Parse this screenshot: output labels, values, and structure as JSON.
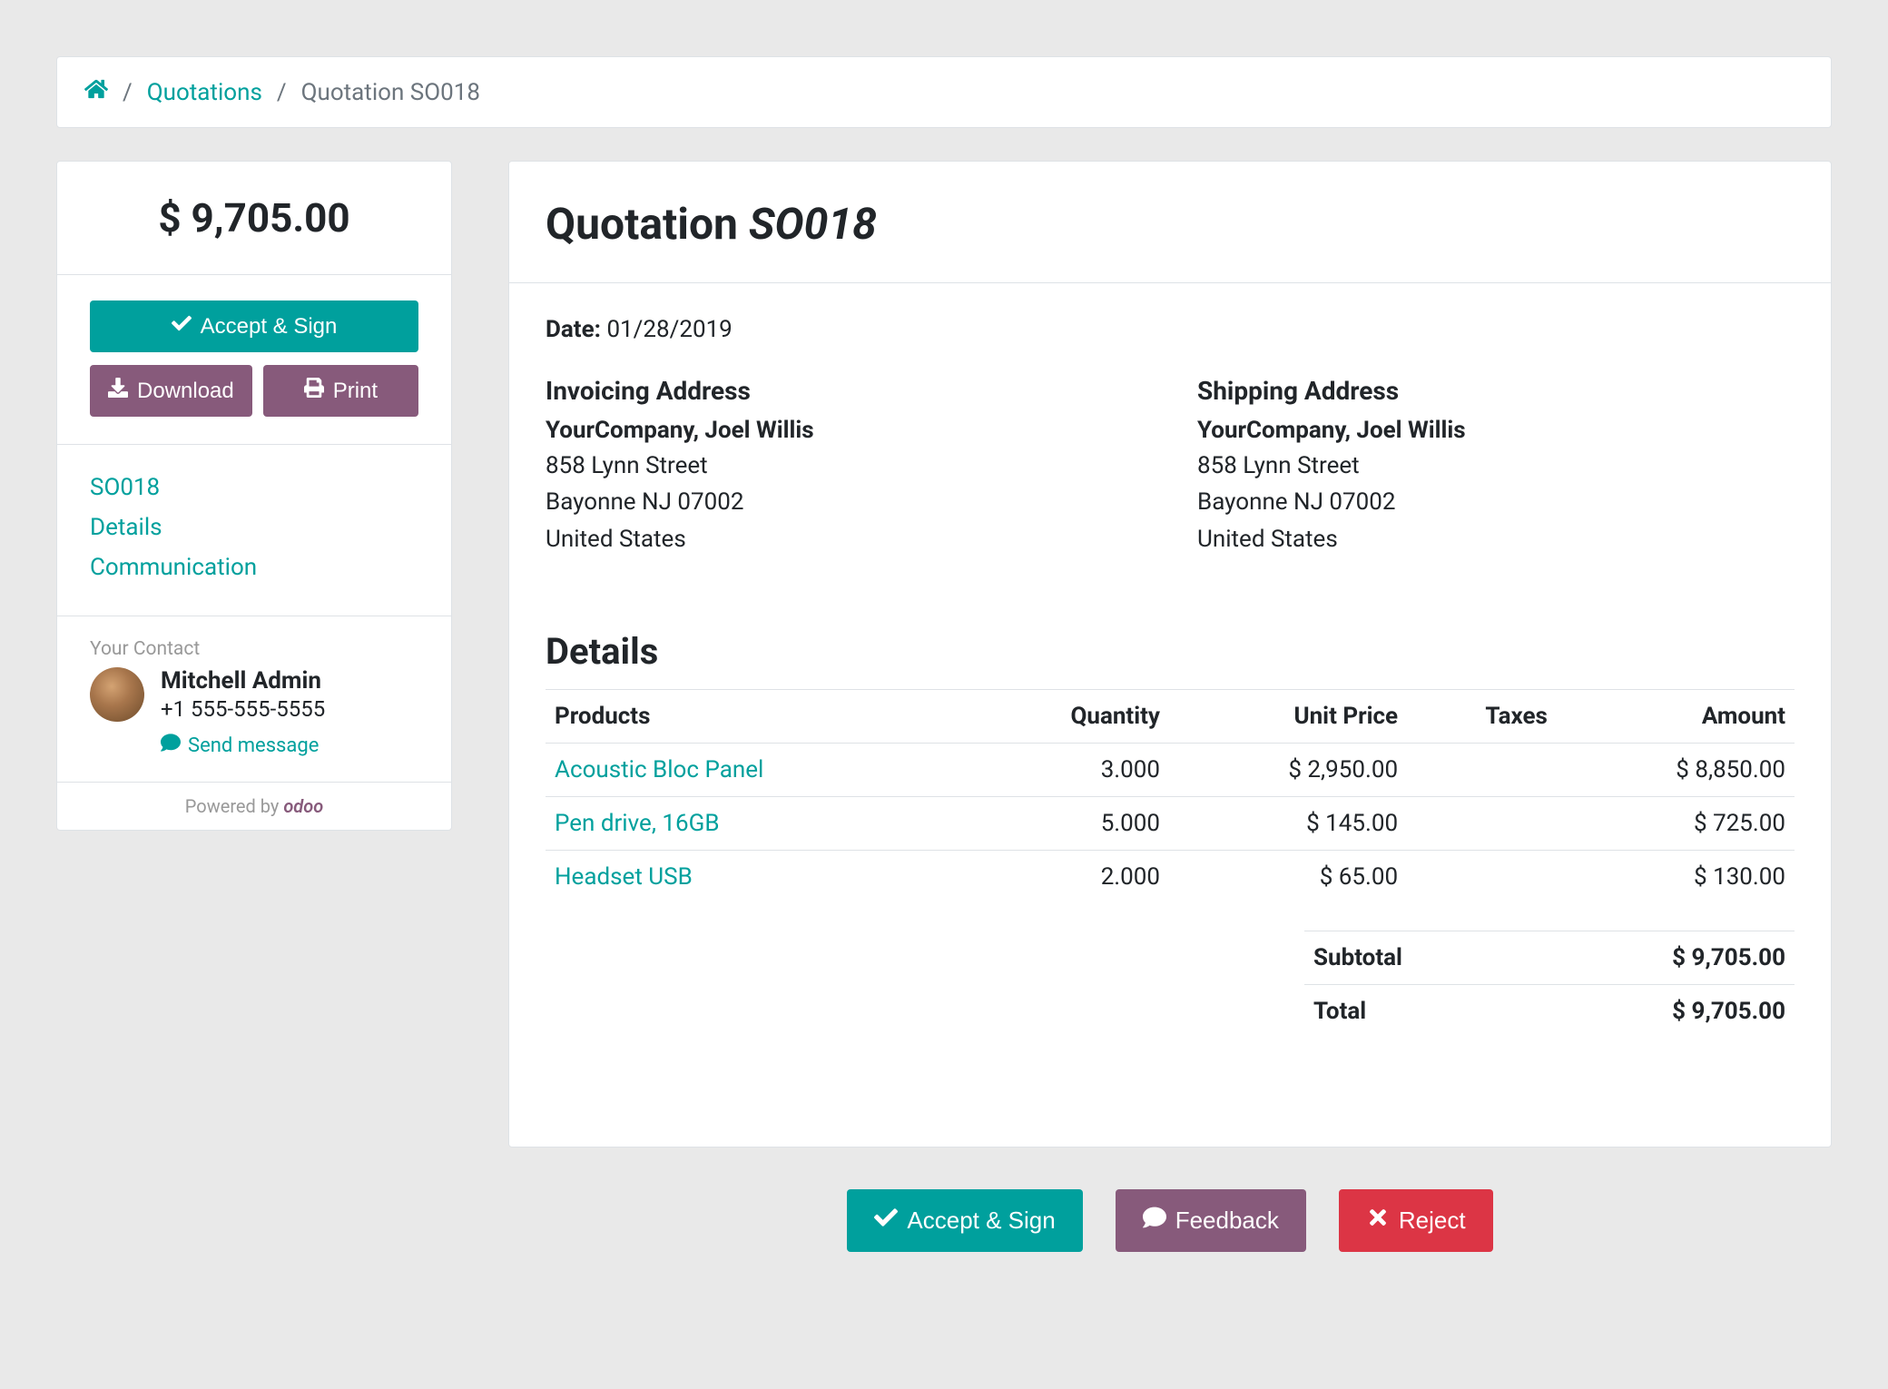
{
  "breadcrumb": {
    "quotations_label": "Quotations",
    "current_label": "Quotation SO018"
  },
  "sidebar": {
    "price": "$ 9,705.00",
    "accept_sign_label": "Accept & Sign",
    "download_label": "Download",
    "print_label": "Print",
    "nav": {
      "so_link": "SO018",
      "details_link": "Details",
      "communication_link": "Communication"
    },
    "contact": {
      "heading": "Your Contact",
      "name": "Mitchell Admin",
      "phone": "+1 555-555-5555",
      "send_msg_label": "Send message"
    },
    "powered_by_label": "Powered by",
    "powered_brand": "odoo"
  },
  "main": {
    "title_prefix": "Quotation ",
    "title_id": "SO018",
    "date_label": "Date:",
    "date_value": "01/28/2019",
    "invoicing_address": {
      "heading": "Invoicing Address",
      "company": "YourCompany, Joel Willis",
      "line1": "858 Lynn Street",
      "line2": "Bayonne NJ 07002",
      "country": "United States"
    },
    "shipping_address": {
      "heading": "Shipping Address",
      "company": "YourCompany, Joel Willis",
      "line1": "858 Lynn Street",
      "line2": "Bayonne NJ 07002",
      "country": "United States"
    },
    "details": {
      "heading": "Details",
      "columns": {
        "products": "Products",
        "quantity": "Quantity",
        "unit_price": "Unit Price",
        "taxes": "Taxes",
        "amount": "Amount"
      },
      "rows": [
        {
          "product": "Acoustic Bloc Panel",
          "quantity": "3.000",
          "unit_price": "$ 2,950.00",
          "taxes": "",
          "amount": "$ 8,850.00"
        },
        {
          "product": "Pen drive, 16GB",
          "quantity": "5.000",
          "unit_price": "$ 145.00",
          "taxes": "",
          "amount": "$ 725.00"
        },
        {
          "product": "Headset USB",
          "quantity": "2.000",
          "unit_price": "$ 65.00",
          "taxes": "",
          "amount": "$ 130.00"
        }
      ],
      "subtotal_label": "Subtotal",
      "subtotal_value": "$ 9,705.00",
      "total_label": "Total",
      "total_value": "$ 9,705.00"
    }
  },
  "footer": {
    "accept_sign_label": "Accept & Sign",
    "feedback_label": "Feedback",
    "reject_label": "Reject"
  }
}
